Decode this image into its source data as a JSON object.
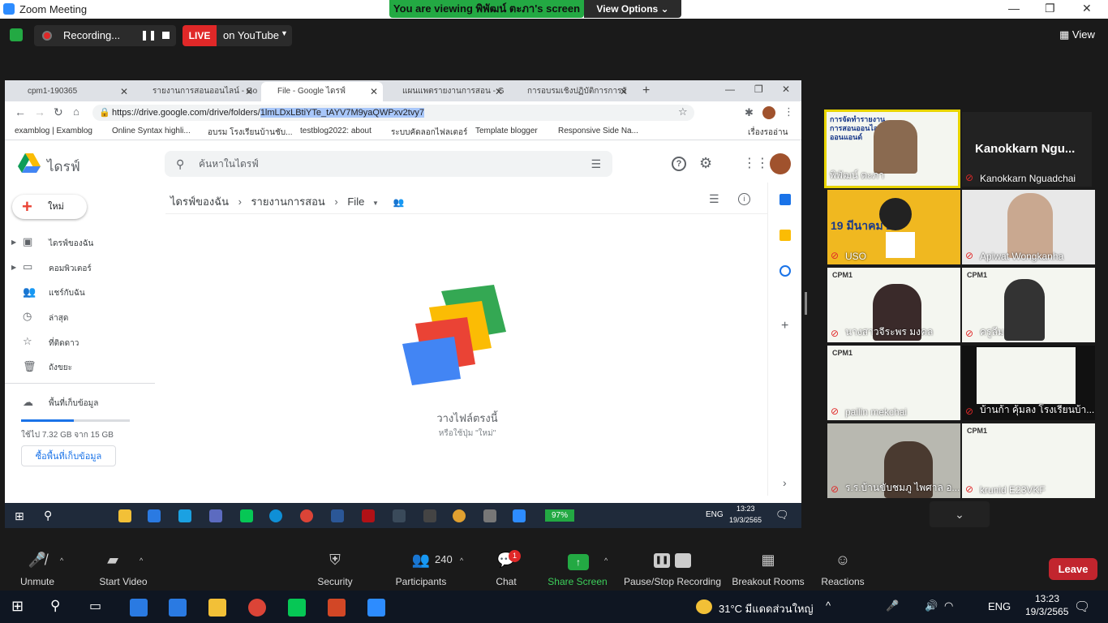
{
  "zoom": {
    "window_title": "Zoom Meeting",
    "viewing_banner": "You are viewing พิพัฒน์ ตะภา's screen",
    "view_options": "View Options",
    "recording": "Recording...",
    "live": "LIVE",
    "live_target": "on YouTube",
    "view": "View"
  },
  "chrome": {
    "tabs": [
      {
        "label": "cpm1-190365"
      },
      {
        "label": "รายงานการสอนออนไลน์ - Go"
      },
      {
        "label": "File - Google ไดรฟ์"
      },
      {
        "label": "แผนแพตรายงานการสอน - G"
      },
      {
        "label": "การอบรมเชิงปฏิบัติการการจั"
      }
    ],
    "url_prefix": "https://drive.google.com/drive/folders/",
    "url_selected": "1lmLDxLBtiYTe_tAYV7M9yaQWPxv2tvy7",
    "bookmarks": [
      "examblog | Examblog",
      "Online Syntax highli...",
      "อบรม โรงเรียนบ้านชับ...",
      "testblog2022: about",
      "ระบบคัดลอกไฟลเตอร์",
      "Template blogger",
      "Responsive Side Na...",
      "เรื่องรออ่าน"
    ]
  },
  "drive": {
    "app_name": "ไดรฟ์",
    "search_placeholder": "ค้นหาในไดรฟ์",
    "new_label": "ใหม่",
    "sidebar": [
      "ไดรฟ์ของฉัน",
      "คอมพิวเตอร์",
      "แชร์กับฉัน",
      "ล่าสุด",
      "ที่ติดดาว",
      "ถังขยะ"
    ],
    "storage_label": "พื้นที่เก็บข้อมูล",
    "storage_used": "ใช้ไป 7.32 GB จาก 15 GB",
    "storage_fraction": 0.488,
    "buy_storage": "ซื้อพื้นที่เก็บข้อมูล",
    "breadcrumb": [
      "ไดรฟ์ของฉัน",
      "รายงานการสอน",
      "File"
    ],
    "drop_title": "วางไฟล์ตรงนี้",
    "drop_sub": "หรือใช้ปุ่ม \"ใหม่\""
  },
  "inner_taskbar": {
    "battery": "97%",
    "lang": "ENG",
    "time": "13:23",
    "date": "19/3/2565"
  },
  "participants_gallery": [
    {
      "name": "พิพัฒน์ ตะภา",
      "title_overlay": "การจัดทำรายงานการสอนออนไลน์ ออนแอนด์"
    },
    {
      "name": "Kanokkarn Nguadchai",
      "big_name": "Kanokkarn Ngu..."
    },
    {
      "name": "USO",
      "slide_date": "19 มีนาคม 2"
    },
    {
      "name": "Apiwat Wongkanha"
    },
    {
      "name": "นางสาวจีระพร มงคล"
    },
    {
      "name": "ครูลีม"
    },
    {
      "name": "pailin mekchai"
    },
    {
      "name": "บ้านก้า คุ้มลง โรงเรียนบ้า..."
    },
    {
      "name": "ร.ร.บ้านขับชมภู ไพศาล อ..."
    },
    {
      "name": "krunid E23VKF"
    }
  ],
  "bottom_toolbar": {
    "unmute": "Unmute",
    "start_video": "Start Video",
    "security": "Security",
    "participants": "Participants",
    "participants_count": "240",
    "chat": "Chat",
    "chat_badge": "1",
    "share_screen": "Share Screen",
    "pause_stop": "Pause/Stop Recording",
    "breakout": "Breakout Rooms",
    "reactions": "Reactions",
    "leave": "Leave"
  },
  "outer_taskbar": {
    "weather": "31°C มีแดดส่วนใหญ่",
    "lang": "ENG",
    "time": "13:23",
    "date": "19/3/2565"
  },
  "colors": {
    "zoom_green": "#23a943",
    "live_red": "#e02828",
    "leave_red": "#c2252e",
    "drive_blue": "#1a73e8"
  }
}
